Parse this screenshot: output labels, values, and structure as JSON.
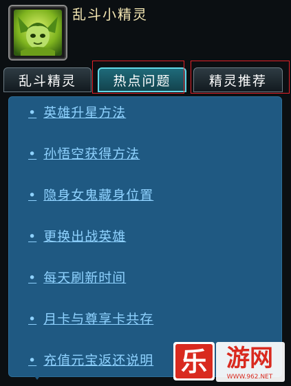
{
  "app": {
    "title": "乱斗小精灵"
  },
  "tabs": [
    {
      "label": "乱斗精灵",
      "active": false
    },
    {
      "label": "热点问题",
      "active": true
    },
    {
      "label": "精灵推荐",
      "active": false
    }
  ],
  "faq": {
    "bullet": "•",
    "items": [
      "英雄升星方法",
      "孙悟空获得方法",
      "隐身女鬼藏身位置",
      "更换出战英雄",
      "每天刷新时间",
      "月卡与尊享卡共存",
      "充值元宝返还说明"
    ]
  },
  "watermark": {
    "logo_char1": "乐",
    "logo_text": "游网",
    "url": "WWW.962.NET"
  },
  "colors": {
    "title": "#f3e6b2",
    "panel": "#1f5982",
    "link": "#8fd2ff",
    "active_tab": "#1e6a79",
    "highlight": "#e52128"
  }
}
